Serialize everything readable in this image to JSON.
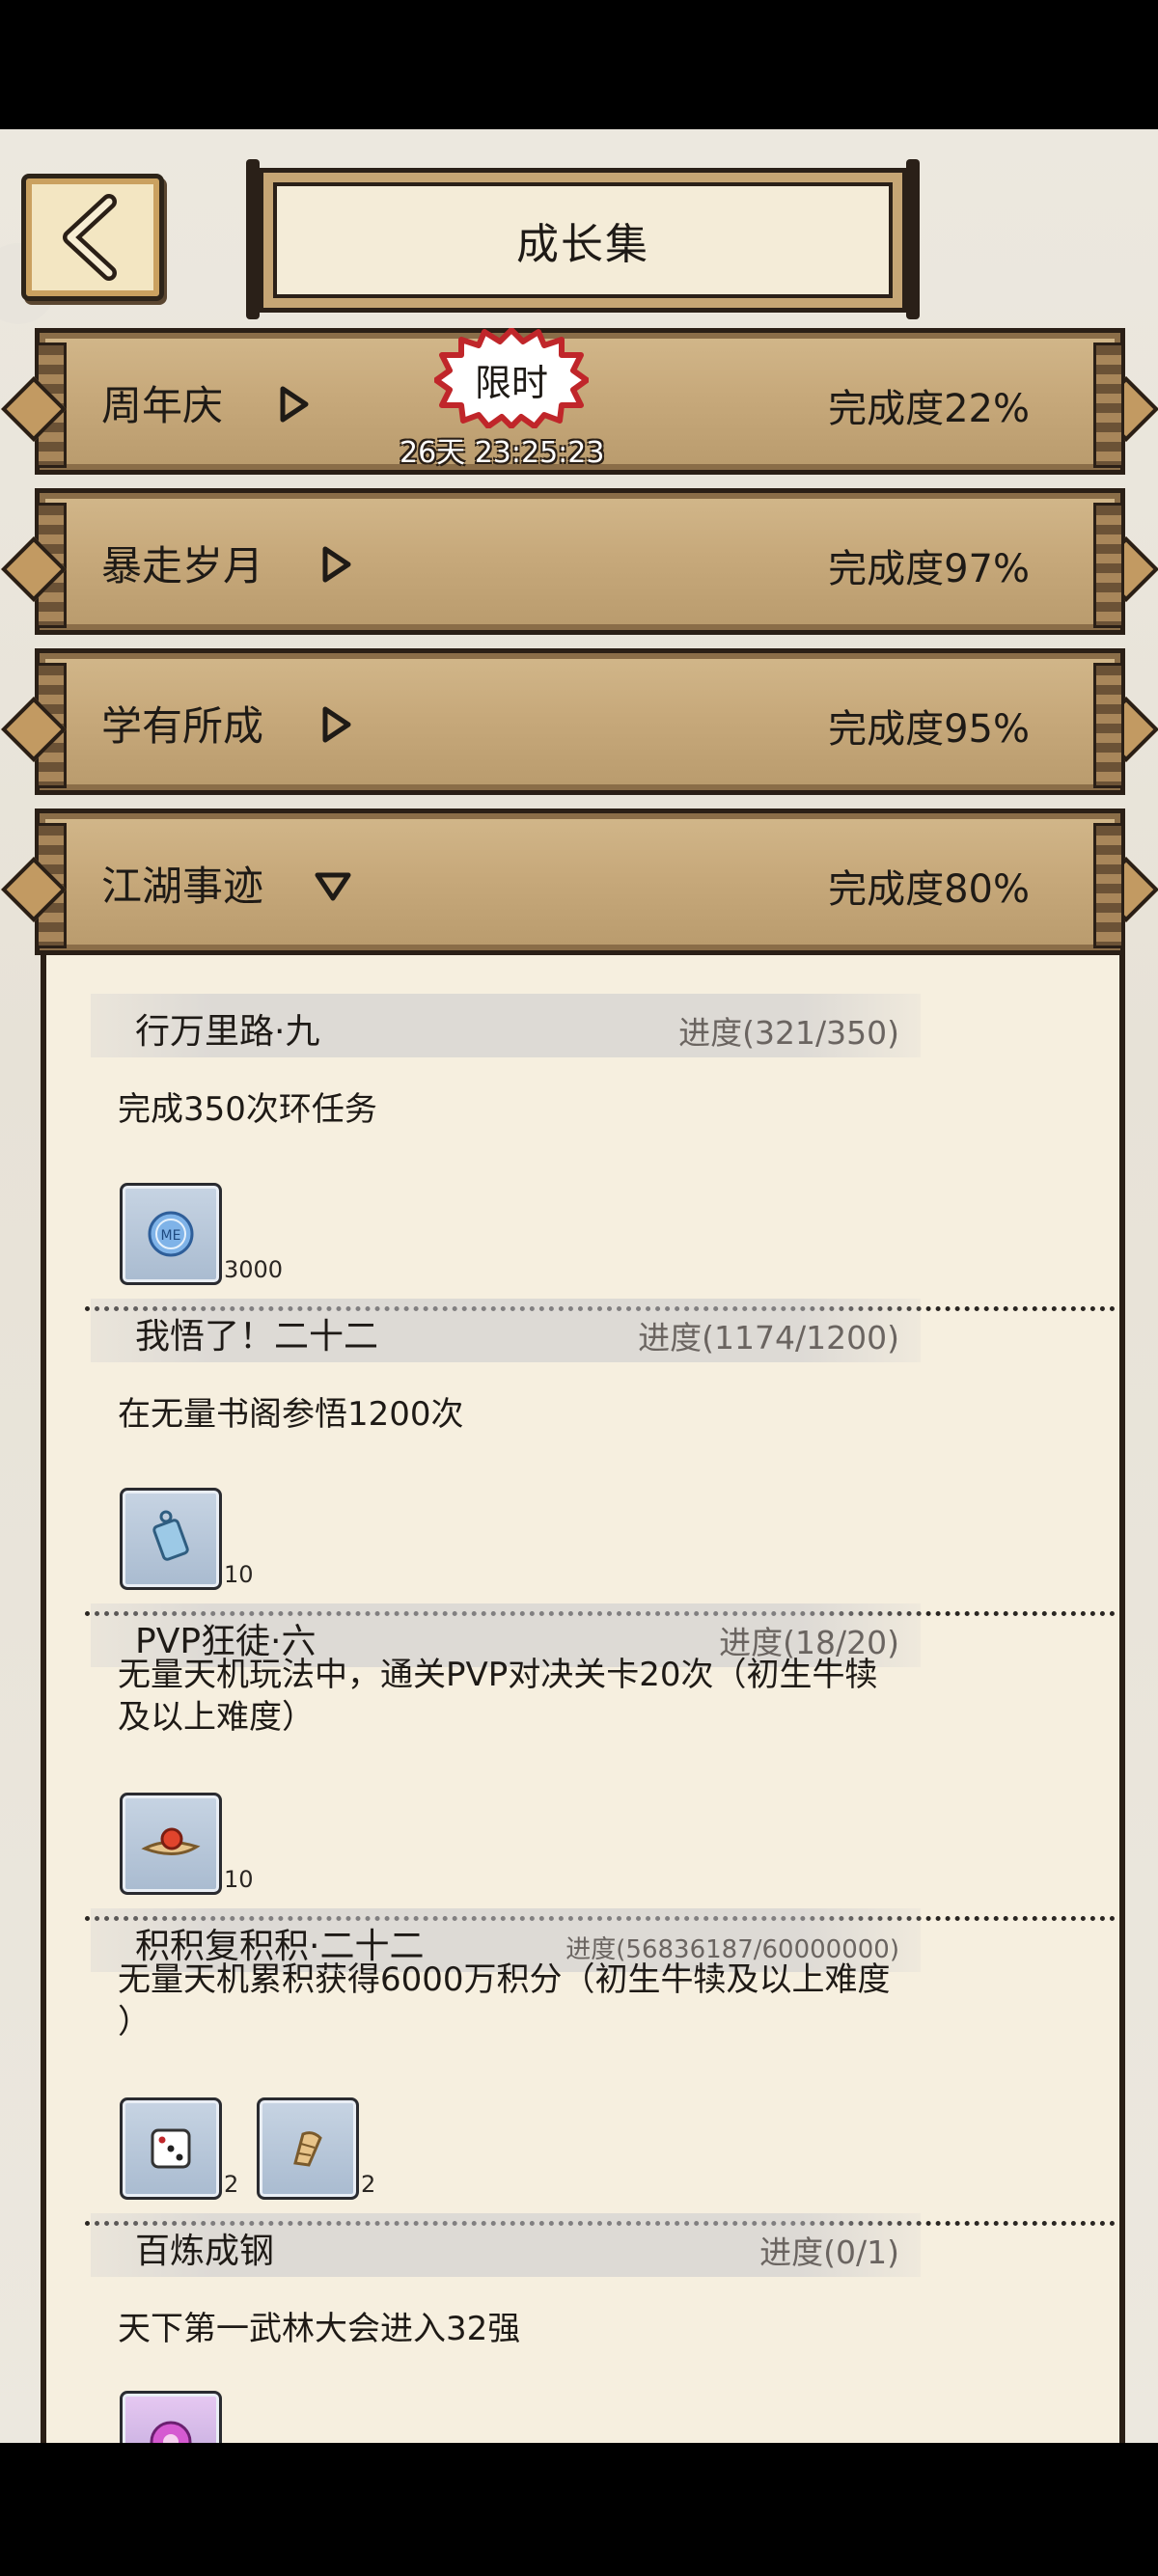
{
  "header": {
    "title": "成长集",
    "back_icon": "back-arrow-icon",
    "side_badge": "e"
  },
  "categories": [
    {
      "name": "周年庆",
      "progress": "完成度22%",
      "expanded": false,
      "limited": true,
      "limit_label": "限时",
      "timer": "26天 23:25:23"
    },
    {
      "name": "暴走岁月",
      "progress": "完成度97%",
      "expanded": false
    },
    {
      "name": "学有所成",
      "progress": "完成度95%",
      "expanded": false
    },
    {
      "name": "江湖事迹",
      "progress": "完成度80%",
      "expanded": true
    }
  ],
  "tasks": [
    {
      "name": "行万里路·九",
      "progress": "进度(321/350)",
      "desc": "完成350次环任务",
      "rewards": [
        {
          "icon": "coin-icon",
          "count": "3000"
        }
      ]
    },
    {
      "name": "我悟了！二十二",
      "progress": "进度(1174/1200)",
      "desc": "在无量书阁参悟1200次",
      "rewards": [
        {
          "icon": "book-token-icon",
          "count": "10"
        }
      ]
    },
    {
      "name": "PVP狂徒·六",
      "progress": "进度(18/20)",
      "desc": "无量天机玩法中，通关PVP对决关卡20次（初生牛犊\n及以上难度）",
      "rewards": [
        {
          "icon": "scroll-orb-icon",
          "count": "10"
        }
      ]
    },
    {
      "name": "积积复积积·二十二",
      "progress": "进度(56836187/60000000)",
      "desc": "无量天机累积获得6000万积分（初生牛犊及以上难度\n）",
      "rewards": [
        {
          "icon": "dice-icon",
          "count": "2"
        },
        {
          "icon": "fan-icon",
          "count": "2"
        }
      ]
    },
    {
      "name": "百炼成钢",
      "progress": "进度(0/1)",
      "desc": "天下第一武林大会进入32强",
      "rewards": [
        {
          "icon": "flower-emblem-icon",
          "count": ""
        }
      ]
    }
  ],
  "colors": {
    "bar": "#c7a97b",
    "panel": "#f6efdf",
    "ink": "#1e1a16",
    "progress_gray": "#6a6460"
  }
}
